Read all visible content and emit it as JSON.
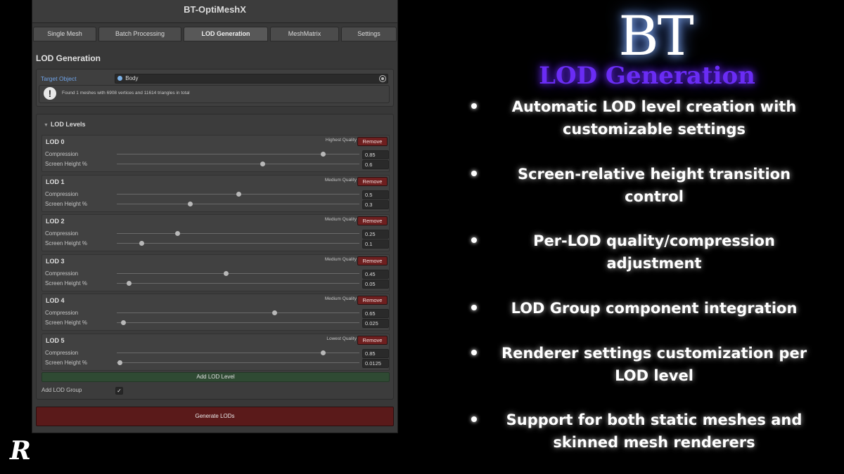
{
  "window": {
    "title": "BT-OptiMeshX"
  },
  "tabs": [
    {
      "label": "Single Mesh",
      "active": false
    },
    {
      "label": "Batch Processing",
      "active": false
    },
    {
      "label": "LOD Generation",
      "active": true
    },
    {
      "label": "MeshMatrix",
      "active": false
    },
    {
      "label": "Settings",
      "active": false
    }
  ],
  "section_title": "LOD Generation",
  "target": {
    "label": "Target Object",
    "value": "Body",
    "info": "Found 1 meshes with 6908 vertices and 11614 triangles in total"
  },
  "lod_section": {
    "title": "LOD Levels",
    "compression_label": "Compression",
    "screen_height_label": "Screen Height %",
    "remove_label": "Remove",
    "levels": [
      {
        "name": "LOD 0",
        "quality": "Highest Quality",
        "compression": "0.85",
        "screen_height": "0.6"
      },
      {
        "name": "LOD 1",
        "quality": "Medium Quality",
        "compression": "0.5",
        "screen_height": "0.3"
      },
      {
        "name": "LOD 2",
        "quality": "Medium Quality",
        "compression": "0.25",
        "screen_height": "0.1"
      },
      {
        "name": "LOD 3",
        "quality": "Medium Quality",
        "compression": "0.45",
        "screen_height": "0.05"
      },
      {
        "name": "LOD 4",
        "quality": "Medium Quality",
        "compression": "0.65",
        "screen_height": "0.025"
      },
      {
        "name": "LOD 5",
        "quality": "Lowest Quality",
        "compression": "0.85",
        "screen_height": "0.0125"
      }
    ],
    "add_button": "Add LOD Level",
    "add_group_label": "Add LOD Group",
    "add_group_checked": "✓"
  },
  "generate_button": "Generate LODs",
  "slide": {
    "logo": "BT",
    "title": "LOD Generation",
    "title_color": "#6a2cf5",
    "bullets": [
      "Automatic LOD level creation with customizable settings",
      "Screen-relative height transition control",
      "Per-LOD quality/compression adjustment",
      "LOD Group component integration",
      "Renderer settings customization per LOD level",
      "Support for both static meshes and skinned mesh renderers"
    ]
  },
  "brand_mark": "R"
}
